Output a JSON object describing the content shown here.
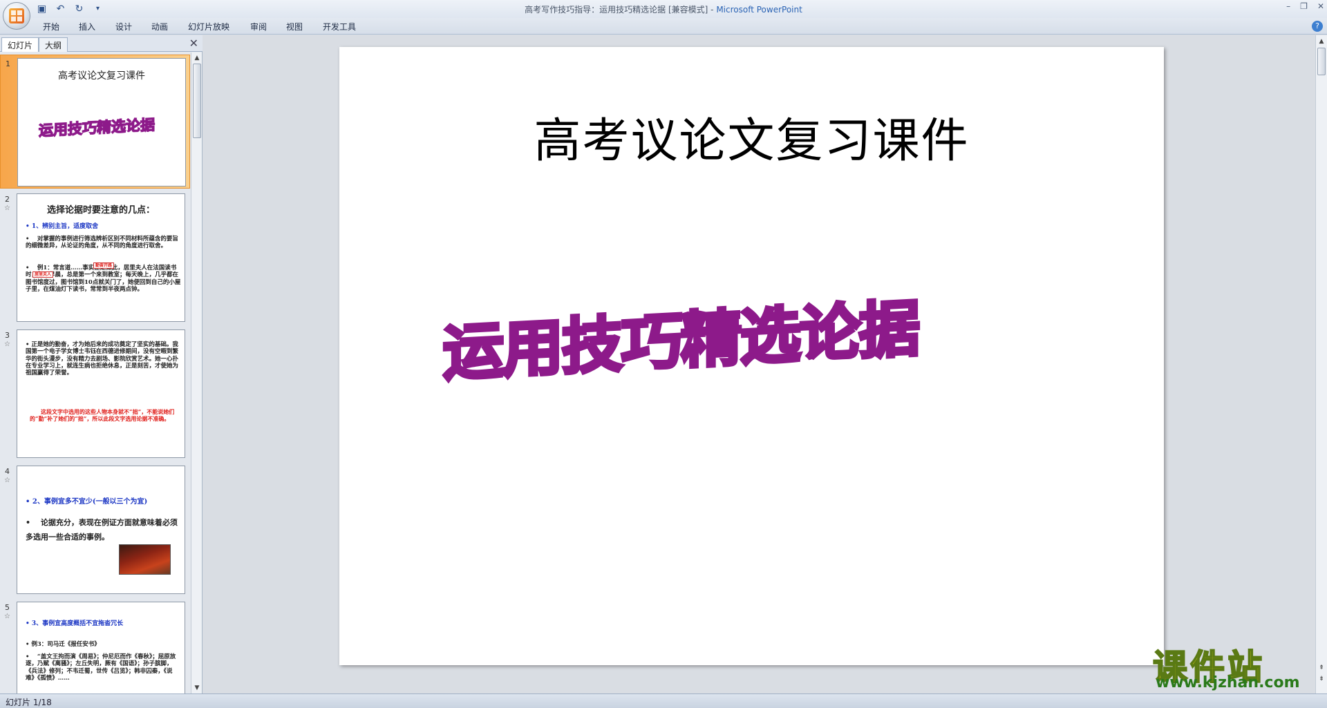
{
  "window": {
    "title_doc": "高考写作技巧指导：运用技巧精选论据 [兼容模式]",
    "title_sep": " - ",
    "title_app": "Microsoft PowerPoint",
    "controls": [
      "–",
      "❐",
      "✕"
    ]
  },
  "qat": {
    "save_icon": "▣",
    "undo_icon": "↶",
    "redo_icon": "↻",
    "more_icon": "▾"
  },
  "ribbon_tabs": [
    "开始",
    "插入",
    "设计",
    "动画",
    "幻灯片放映",
    "审阅",
    "视图",
    "开发工具"
  ],
  "help_label": "?",
  "panel": {
    "tab_slides": "幻灯片",
    "tab_outline": "大纲",
    "close": "✕"
  },
  "thumbnails": [
    {
      "num": "1",
      "title": "高考议论文复习课件",
      "wordart": "运用技巧精选论据"
    },
    {
      "num": "2",
      "star": "☆",
      "title": "选择论据时要注意的几点：",
      "heading": "• 1、辨别主旨，适度取舍",
      "body": "• 　对掌握的事例进行筛选辨析区别不同材料所蕴含的要旨的细微差异，从论证的角度，从不同的角度进行取舍。",
      "body2": "• 　例1：常言道……事实正是如此，居里夫人在法国读书时，每天早晨，总是第一个来到教室；每天晚上，几乎都在图书馆度过，图书馆到10点就关门了，她便回到自己的小屋子里，在煤油灯下读书，常常到半夜两点钟。",
      "tag1": "勤奋开路",
      "tag2": "居里夫人"
    },
    {
      "num": "3",
      "star": "☆",
      "body": "• 正是她的勤奋，才为她后来的成功奠定了坚实的基础。我国第一个电子学女博士韦钰在西德进修期间，没有空暇到繁华的街头漫步，没有精力去剧场、影院欣赏艺术。她一心扑在专业学习上，就连生病也拒绝休息，正是刻苦，才使她为祖国赢得了荣誉。",
      "note": "　　这段文字中选用的这些人物本身就不“拙”，不能说她们的“勤”补了她们的“拙”，所以此段文字选用论据不准确。"
    },
    {
      "num": "4",
      "star": "☆",
      "heading": "• 2、事例宜多不宜少(一般以三个为宜)",
      "body": "• 　论据充分，表现在例证方面就意味着必须多选用一些合适的事例。"
    },
    {
      "num": "5",
      "star": "☆",
      "heading": "• 3、事例宜高度概括不宜拖沓冗长",
      "sub": "• 例3：司马迁《报任安书》",
      "body": "• 　“盖文王拘而演《周易》；仲尼厄而作《春秋》；屈原放逐，乃赋《离骚》；左丘失明，厥有《国语》；孙子膑脚，《兵法》修列；不韦迁蜀，世传《吕览》；韩非囚秦，《说难》《孤愤》……"
    }
  ],
  "main_slide": {
    "title": "高考议论文复习课件",
    "wordart": "运用技巧精选论据"
  },
  "status": {
    "slide_indicator": "幻灯片 1/18"
  },
  "watermark": {
    "cn": "课件站",
    "url": "www.kjzhan.com"
  },
  "colors": {
    "wordart_outline": "#8d1a8a",
    "selected_thumb": "#f7a64b",
    "blue_heading": "#1b36c4",
    "red_text": "#e0201c"
  }
}
